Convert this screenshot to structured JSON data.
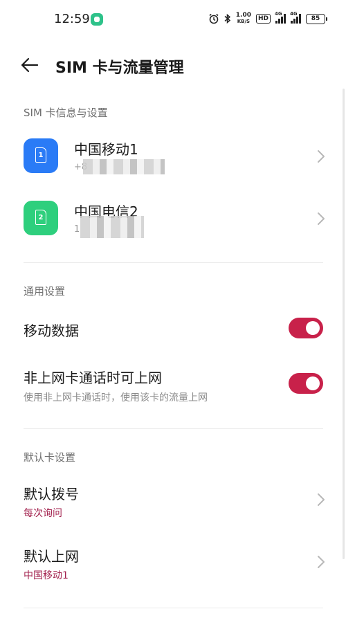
{
  "status_bar": {
    "time": "12:59",
    "app_icon": "green-app-icon",
    "alarm_icon": "alarm-clock-icon",
    "bluetooth_icon": "bluetooth-icon",
    "speed_value": "1.00",
    "speed_unit": "KB/S",
    "hd_label": "HD",
    "sim1_tech": "4G",
    "sim2_tech": "4G",
    "battery": "85"
  },
  "header": {
    "back_icon": "arrow-left-icon",
    "title": "SIM 卡与流量管理"
  },
  "sim_section": {
    "title": "SIM 卡信息与设置",
    "cards": [
      {
        "name": "中国移动1",
        "number_prefix": "+8",
        "slot": "1",
        "color": "#2a7bf6"
      },
      {
        "name": "中国电信2",
        "number_prefix": "1",
        "slot": "2",
        "color": "#2ecf7d"
      }
    ]
  },
  "general_section": {
    "title": "通用设置",
    "mobile_data": {
      "label": "移动数据",
      "enabled": true
    },
    "call_data": {
      "label": "非上网卡通话时可上网",
      "description": "使用非上网卡通话时，使用该卡的流量上网",
      "enabled": true
    }
  },
  "default_section": {
    "title": "默认卡设置",
    "default_call": {
      "label": "默认拨号",
      "value": "每次询问"
    },
    "default_data": {
      "label": "默认上网",
      "value": "中国移动1"
    }
  },
  "colors": {
    "accent": "#c8214a",
    "value_text": "#a3234f"
  }
}
